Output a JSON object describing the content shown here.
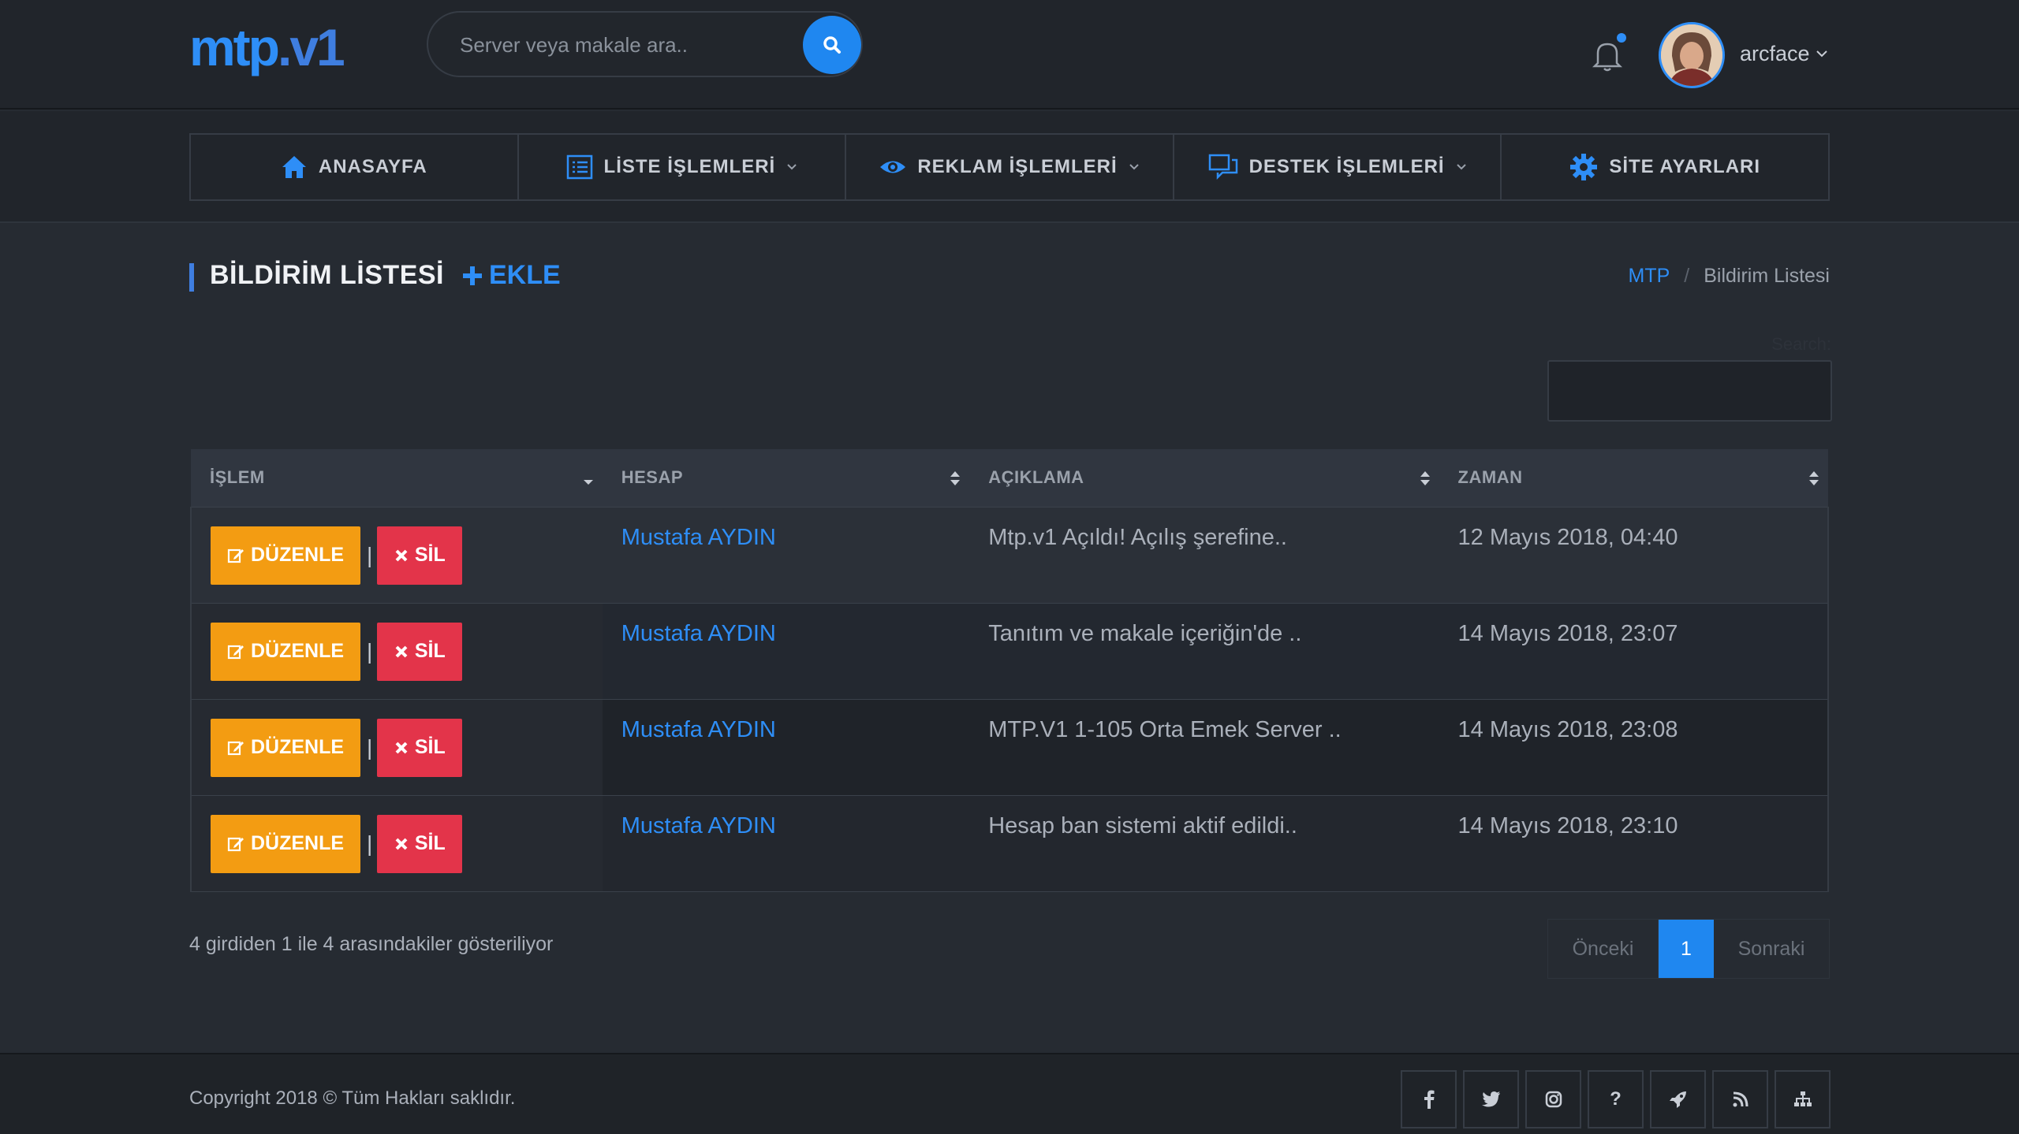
{
  "header": {
    "logo_main": "mtp",
    "logo_suffix": ".v1",
    "search_placeholder": "Server veya makale ara..",
    "username": "arcface"
  },
  "nav": {
    "items": [
      {
        "label": "ANASAYFA",
        "icon": "home-icon",
        "dropdown": false
      },
      {
        "label": "LİSTE İŞLEMLERİ",
        "icon": "list-icon",
        "dropdown": true
      },
      {
        "label": "REKLAM İŞLEMLERİ",
        "icon": "eye-icon",
        "dropdown": true
      },
      {
        "label": "DESTEK İŞLEMLERİ",
        "icon": "chat-icon",
        "dropdown": true
      },
      {
        "label": "SİTE AYARLARI",
        "icon": "gear-icon",
        "dropdown": false
      }
    ]
  },
  "page": {
    "title": "BİLDİRİM LİSTESİ",
    "add_label": "EKLE",
    "breadcrumb_home": "MTP",
    "breadcrumb_sep": "/",
    "breadcrumb_current": "Bildirim Listesi",
    "search_label": "Search:"
  },
  "table": {
    "columns": [
      "İŞLEM",
      "HESAP",
      "AÇIKLAMA",
      "ZAMAN"
    ],
    "edit_label": "DÜZENLE",
    "delete_label": "SİL",
    "rows": [
      {
        "hesap": "Mustafa AYDIN",
        "aciklama": "Mtp.v1 Açıldı! Açılış şerefine..",
        "zaman": "12 Mayıs 2018, 04:40"
      },
      {
        "hesap": "Mustafa AYDIN",
        "aciklama": "Tanıtım ve makale içeriğin'de ..",
        "zaman": "14 Mayıs 2018, 23:07"
      },
      {
        "hesap": "Mustafa AYDIN",
        "aciklama": "MTP.V1 1-105 Orta Emek Server ..",
        "zaman": "14 Mayıs 2018, 23:08"
      },
      {
        "hesap": "Mustafa AYDIN",
        "aciklama": "Hesap ban sistemi aktif edildi..",
        "zaman": "14 Mayıs 2018, 23:10"
      }
    ]
  },
  "info": "4 girdiden 1 ile 4 arasındakiler gösteriliyor",
  "paging": {
    "prev": "Önceki",
    "current": "1",
    "next": "Sonraki"
  },
  "footer": {
    "copyright": "Copyright 2018 © Tüm Hakları saklıdır.",
    "socials": [
      "facebook-icon",
      "twitter-icon",
      "instagram-icon",
      "help-icon",
      "rocket-icon",
      "rss-icon",
      "sitemap-icon"
    ],
    "help_glyph": "?"
  },
  "colors": {
    "accent": "#2e8ef7",
    "edit": "#f39c12",
    "delete": "#e3344a"
  }
}
